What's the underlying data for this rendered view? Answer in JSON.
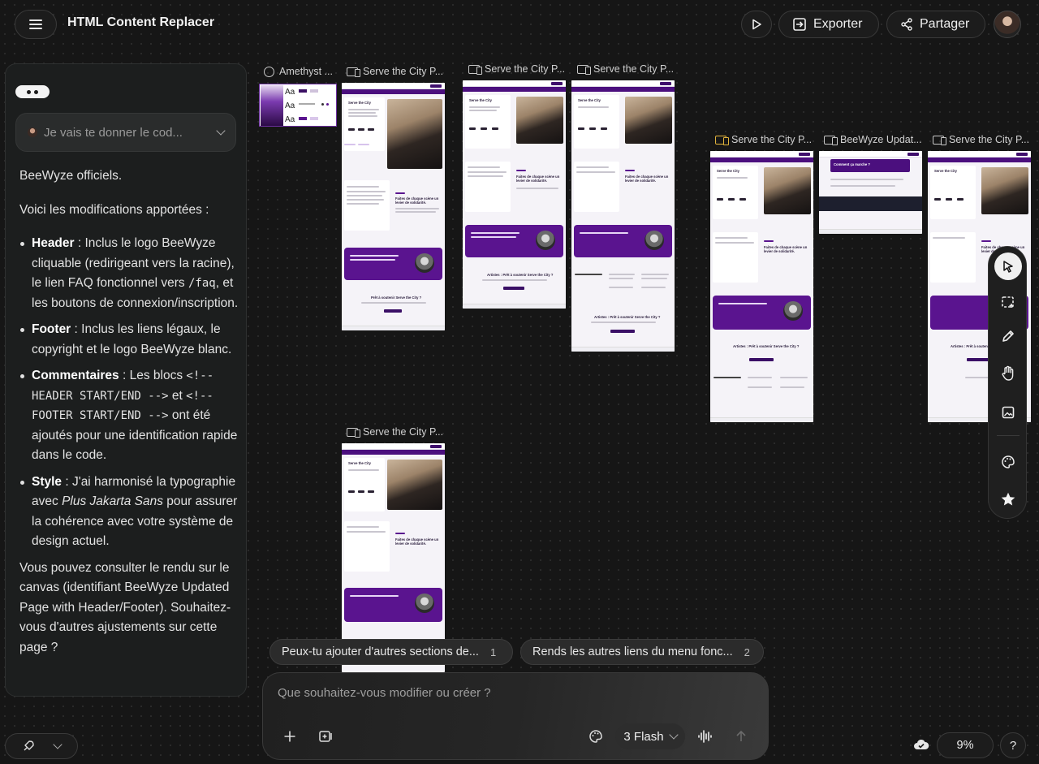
{
  "app": {
    "title": "HTML Content Replacer"
  },
  "toolbar": {
    "export_label": "Exporter",
    "share_label": "Partager"
  },
  "chat": {
    "prompt_preview": "Je vais te donner le cod...",
    "intro_tail": "BeeWyze officiels.",
    "lead": "Voici les modifications apportées :",
    "bullets": [
      {
        "label": "Header",
        "text_before": " : Inclus le logo BeeWyze cliquable (redirigeant vers la racine), le lien FAQ fonctionnel vers ",
        "code": "/faq",
        "text_after": ", et les boutons de connexion/inscription."
      },
      {
        "label": "Footer",
        "text": " : Inclus les liens légaux, le copyright et le logo BeeWyze blanc."
      },
      {
        "label": "Commentaires",
        "text_before": " : Les blocs ",
        "code1": "<!-- HEADER START/END -->",
        "text_mid": " et ",
        "code2": "<!-- FOOTER START/END -->",
        "text_after": " ont été ajoutés pour une identification rapide dans le code."
      },
      {
        "label": "Style",
        "text_before": " : J'ai harmonisé la typographie avec ",
        "em": "Plus Jakarta Sans",
        "text_after": " pour assurer la cohérence avec votre système de design actuel."
      }
    ],
    "closing": "Vous pouvez consulter le rendu sur le canvas (identifiant BeeWyze Updated Page with Header/Footer). Souhaitez-vous d'autres ajustements sur cette page ?"
  },
  "canvas": {
    "frames": [
      {
        "label": "Amethyst ...",
        "icon": "palette-icon"
      },
      {
        "label": "Serve the City P...",
        "icon": "device-icon"
      },
      {
        "label": "Serve the City P...",
        "icon": "device-icon"
      },
      {
        "label": "Serve the City P...",
        "icon": "device-icon"
      },
      {
        "label": "Serve the City P...",
        "icon": "device-icon",
        "selected": true
      },
      {
        "label": "BeeWyze Updat...",
        "icon": "device-icon"
      },
      {
        "label": "Serve the City P...",
        "icon": "device-icon"
      },
      {
        "label": "Serve the City P...",
        "icon": "device-icon"
      }
    ],
    "theme_swatch_text": "Aa",
    "page_text": {
      "hero_title": "Serve the City",
      "section_title": "Faites de chaque scène un levier de solidarité.",
      "cta_title": "Prêt à soutenir Serve the City ?",
      "cta_title_alt": "Artistes : Prêt à soutenir Serve the City ?",
      "faq_heading": "Comment ça marche ?"
    }
  },
  "suggestions": [
    {
      "label": "Peux-tu ajouter d'autres sections de...",
      "count": "1"
    },
    {
      "label": "Rends les autres liens du menu fonc...",
      "count": "2"
    }
  ],
  "composer": {
    "placeholder": "Que souhaitez-vous modifier ou créer ?",
    "model": "3 Flash"
  },
  "zoom": "9%",
  "help": "?",
  "colors": {
    "accent_purple": "#4b0f7e",
    "selected_frame_icon": "#e2b43c",
    "background": "#161616"
  }
}
